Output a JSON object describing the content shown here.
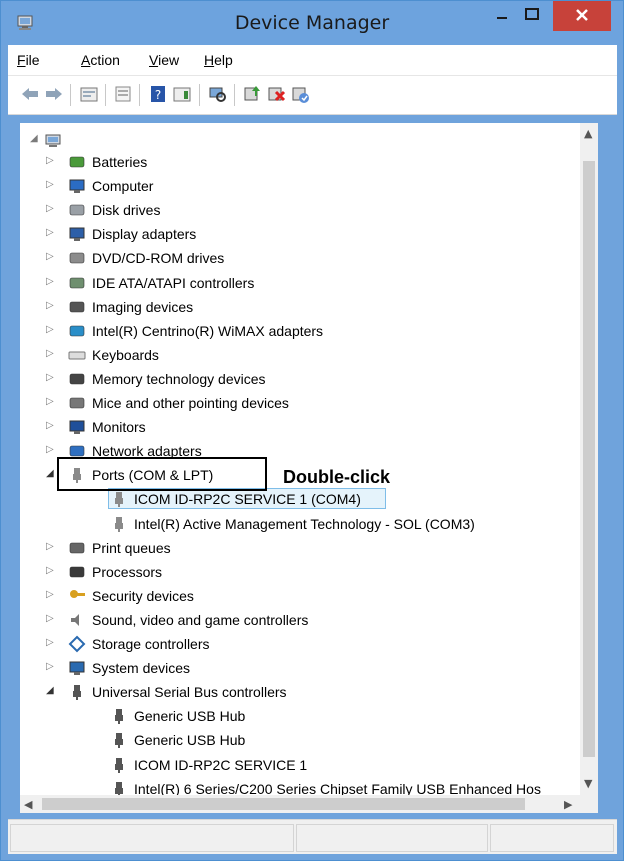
{
  "window": {
    "title": "Device Manager"
  },
  "menu": [
    {
      "label": "File",
      "u": "F",
      "rest": "ile"
    },
    {
      "label": "Action",
      "u": "A",
      "rest": "ction"
    },
    {
      "label": "View",
      "u": "V",
      "rest": "iew"
    },
    {
      "label": "Help",
      "u": "H",
      "rest": "elp"
    }
  ],
  "toolbar": {
    "icons": [
      "back-icon",
      "forward-icon",
      "properties-icon",
      "show-hide-icon",
      "help-icon",
      "view-icon",
      "scan-hardware-icon",
      "update-driver-icon",
      "uninstall-icon",
      "enable-icon"
    ]
  },
  "tree": {
    "root_label": "",
    "categories": [
      {
        "label": "Batteries",
        "expanded": false,
        "icon": "battery-icon"
      },
      {
        "label": "Computer",
        "expanded": false,
        "icon": "computer-icon"
      },
      {
        "label": "Disk drives",
        "expanded": false,
        "icon": "disk-icon"
      },
      {
        "label": "Display adapters",
        "expanded": false,
        "icon": "display-icon"
      },
      {
        "label": "DVD/CD-ROM drives",
        "expanded": false,
        "icon": "dvd-icon"
      },
      {
        "label": "IDE ATA/ATAPI controllers",
        "expanded": false,
        "icon": "ide-icon"
      },
      {
        "label": "Imaging devices",
        "expanded": false,
        "icon": "camera-icon"
      },
      {
        "label": "Intel(R) Centrino(R) WiMAX adapters",
        "expanded": false,
        "icon": "wimax-icon"
      },
      {
        "label": "Keyboards",
        "expanded": false,
        "icon": "keyboard-icon"
      },
      {
        "label": "Memory technology devices",
        "expanded": false,
        "icon": "memory-icon"
      },
      {
        "label": "Mice and other pointing devices",
        "expanded": false,
        "icon": "mouse-icon"
      },
      {
        "label": "Monitors",
        "expanded": false,
        "icon": "monitor-icon"
      },
      {
        "label": "Network adapters",
        "expanded": false,
        "icon": "network-icon"
      },
      {
        "label": "Ports (COM & LPT)",
        "expanded": true,
        "icon": "port-icon"
      },
      {
        "label": "ICOM ID-RP2C SERVICE 1 (COM4)",
        "child": true,
        "selected": true,
        "icon": "port-icon"
      },
      {
        "label": "Intel(R) Active Management Technology - SOL (COM3)",
        "child": true,
        "icon": "port-icon"
      },
      {
        "label": "Print queues",
        "expanded": false,
        "icon": "printer-icon"
      },
      {
        "label": "Processors",
        "expanded": false,
        "icon": "processor-icon"
      },
      {
        "label": "Security devices",
        "expanded": false,
        "icon": "key-icon"
      },
      {
        "label": "Sound, video and game controllers",
        "expanded": false,
        "icon": "speaker-icon"
      },
      {
        "label": "Storage controllers",
        "expanded": false,
        "icon": "storage-icon"
      },
      {
        "label": "System devices",
        "expanded": false,
        "icon": "system-icon"
      },
      {
        "label": "Universal Serial Bus controllers",
        "expanded": true,
        "icon": "usb-icon"
      },
      {
        "label": "Generic USB Hub",
        "child": true,
        "icon": "usb-icon"
      },
      {
        "label": "Generic USB Hub",
        "child": true,
        "icon": "usb-icon"
      },
      {
        "label": "ICOM ID-RP2C SERVICE 1",
        "child": true,
        "icon": "usb-icon"
      },
      {
        "label": "Intel(R) 6 Series/C200 Series Chipset Family USB Enhanced Hos",
        "child": true,
        "icon": "usb-icon"
      }
    ]
  },
  "annotation": {
    "text": "Double-click"
  },
  "colors": {
    "titlebar": "#6da3de",
    "close": "#c7423a",
    "selection": "#e5f3fb",
    "selection_border": "#7fbde8"
  }
}
